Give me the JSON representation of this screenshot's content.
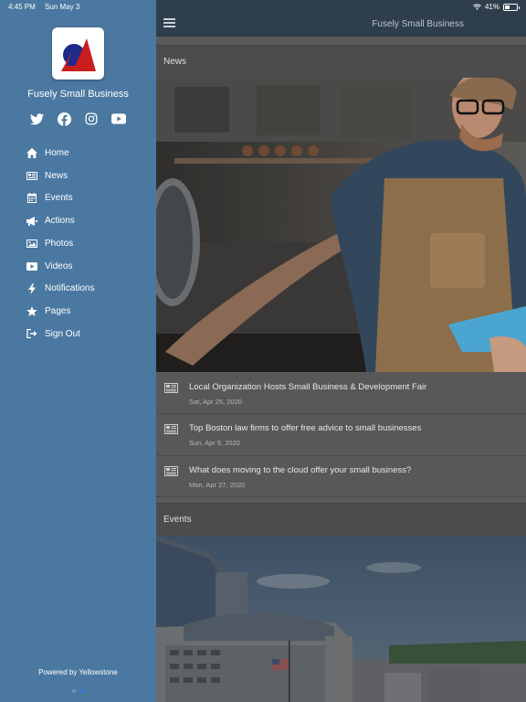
{
  "status": {
    "time": "4:45 PM",
    "date": "Sun May 3",
    "battery": "41%"
  },
  "sidebar": {
    "brand": "Fusely Small Business",
    "social": [
      "twitter-icon",
      "facebook-icon",
      "instagram-icon",
      "youtube-icon"
    ],
    "items": [
      {
        "label": "Home",
        "icon": "home-icon"
      },
      {
        "label": "News",
        "icon": "newspaper-icon"
      },
      {
        "label": "Events",
        "icon": "calendar-icon"
      },
      {
        "label": "Actions",
        "icon": "megaphone-icon"
      },
      {
        "label": "Photos",
        "icon": "image-icon"
      },
      {
        "label": "Videos",
        "icon": "play-icon"
      },
      {
        "label": "Notifications",
        "icon": "bolt-icon"
      },
      {
        "label": "Pages",
        "icon": "star-icon"
      },
      {
        "label": "Sign Out",
        "icon": "sign-out-icon"
      }
    ],
    "powered_by": "Powered by Yellowstone",
    "colors": {
      "background": "#4a78a0",
      "logo_red": "#c81e1e",
      "logo_navy": "#1c2a8a"
    }
  },
  "main": {
    "app_title": "Fusely Small Business",
    "news_header": "News",
    "news_items": [
      {
        "title": "Local Organization Hosts Small Business & Development Fair",
        "date": "Sat, Apr 25, 2020"
      },
      {
        "title": "Top Boston law firms to offer free advice to small businesses",
        "date": "Sun, Apr 5, 2020"
      },
      {
        "title": "What does moving to the cloud offer your small business?",
        "date": "Mon, Apr 27, 2020"
      }
    ],
    "events_header": "Events"
  }
}
